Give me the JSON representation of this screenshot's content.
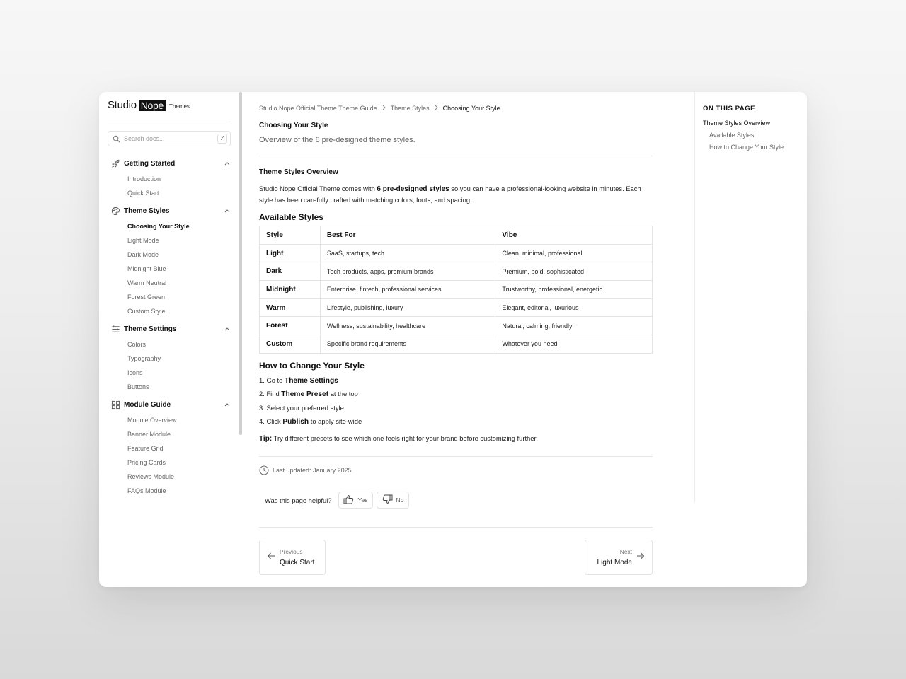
{
  "logo": {
    "word1": "Studio",
    "word2": "Nope",
    "suffix": "Themes"
  },
  "search": {
    "placeholder": "Search docs...",
    "shortcut": "/"
  },
  "sidebar": {
    "groups": [
      {
        "label": "Getting Started",
        "icon": "rocket-icon",
        "items": [
          "Introduction",
          "Quick Start"
        ]
      },
      {
        "label": "Theme Styles",
        "icon": "palette-icon",
        "items": [
          "Choosing Your Style",
          "Light Mode",
          "Dark Mode",
          "Midnight Blue",
          "Warm Neutral",
          "Forest Green",
          "Custom Style"
        ]
      },
      {
        "label": "Theme Settings",
        "icon": "sliders-icon",
        "items": [
          "Colors",
          "Typography",
          "Icons",
          "Buttons"
        ]
      },
      {
        "label": "Module Guide",
        "icon": "grid-icon",
        "items": [
          "Module Overview",
          "Banner Module",
          "Feature Grid",
          "Pricing Cards",
          "Reviews Module",
          "FAQs Module"
        ]
      }
    ],
    "active_item": "Choosing Your Style"
  },
  "breadcrumb": [
    "Studio Nope Official Theme Theme Guide",
    "Theme Styles",
    "Choosing Your Style"
  ],
  "page": {
    "title": "Choosing Your Style",
    "subtitle": "Overview of the 6 pre-designed theme styles.",
    "overview_heading": "Theme Styles Overview",
    "intro_pre": "Studio Nope Official Theme comes with ",
    "intro_bold": "6 pre-designed styles",
    "intro_post": " so you can have a professional-looking website in minutes. Each style has been carefully crafted with matching colors, fonts, and spacing.",
    "available_heading": "Available Styles",
    "table": {
      "headers": [
        "Style",
        "Best For",
        "Vibe"
      ],
      "rows": [
        [
          "Light",
          "SaaS, startups, tech",
          "Clean, minimal, professional"
        ],
        [
          "Dark",
          "Tech products, apps, premium brands",
          "Premium, bold, sophisticated"
        ],
        [
          "Midnight",
          "Enterprise, fintech, professional services",
          "Trustworthy, professional, energetic"
        ],
        [
          "Warm",
          "Lifestyle, publishing, luxury",
          "Elegant, editorial, luxurious"
        ],
        [
          "Forest",
          "Wellness, sustainability, healthcare",
          "Natural, calming, friendly"
        ],
        [
          "Custom",
          "Specific brand requirements",
          "Whatever you need"
        ]
      ]
    },
    "change_heading": "How to Change Your Style",
    "steps": [
      {
        "num": "1.",
        "pre": "Go to ",
        "bold": "Theme Settings",
        "post": ""
      },
      {
        "num": "2.",
        "pre": "Find ",
        "bold": "Theme Preset",
        "post": " at the top"
      },
      {
        "num": "3.",
        "pre": "Select your preferred style",
        "bold": "",
        "post": ""
      },
      {
        "num": "4.",
        "pre": "Click ",
        "bold": "Publish",
        "post": " to apply site-wide"
      }
    ],
    "tip_label": "Tip:",
    "tip_text": " Try different presets to see which one feels right for your brand before customizing further.",
    "last_updated": "Last updated: January 2025",
    "helpful_question": "Was this page helpful?",
    "yes_label": "Yes",
    "no_label": "No",
    "prev_small": "Previous",
    "prev_title": "Quick Start",
    "next_small": "Next",
    "next_title": "Light Mode"
  },
  "toc": {
    "heading": "ON THIS PAGE",
    "items": [
      {
        "label": "Theme Styles Overview",
        "level": 1
      },
      {
        "label": "Available Styles",
        "level": 2
      },
      {
        "label": "How to Change Your Style",
        "level": 2
      }
    ]
  }
}
